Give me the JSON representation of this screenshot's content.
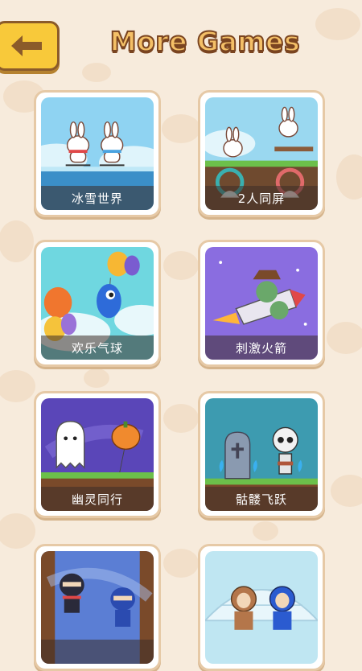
{
  "header": {
    "title": "More Games",
    "back_icon": "left-arrow-icon"
  },
  "colors": {
    "background": "#f7ebdc",
    "back_button": "#f8c93a",
    "title_fill": "#f4c067",
    "title_outline": "#7a4420",
    "card_border": "#e6c9a6"
  },
  "games": [
    {
      "label": "冰雪世界"
    },
    {
      "label": "2人同屏"
    },
    {
      "label": "欢乐气球"
    },
    {
      "label": "刺激火箭"
    },
    {
      "label": "幽灵同行"
    },
    {
      "label": "骷髅飞跃"
    },
    {
      "label": ""
    },
    {
      "label": ""
    }
  ]
}
